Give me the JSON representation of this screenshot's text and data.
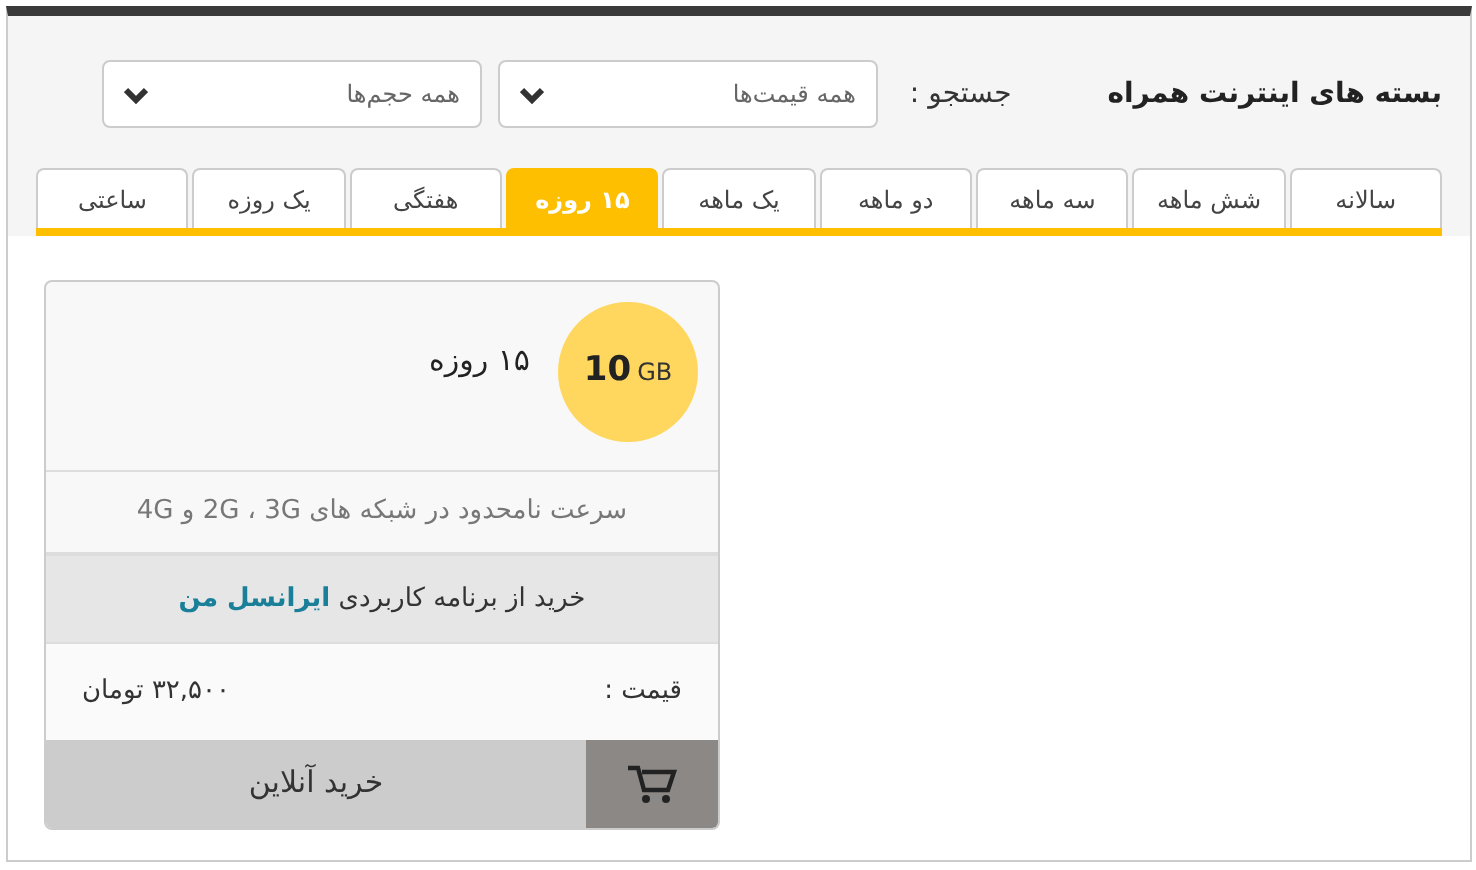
{
  "header": {
    "title": "بسته های اینترنت همراه",
    "search_label": "جستجو :",
    "filters": [
      {
        "value": "همه قیمت‌ها"
      },
      {
        "value": "همه حجم‌ها"
      }
    ]
  },
  "tabs": [
    {
      "label": "سالانه",
      "selected": false
    },
    {
      "label": "شش ماهه",
      "selected": false
    },
    {
      "label": "سه ماهه",
      "selected": false
    },
    {
      "label": "دو ماهه",
      "selected": false
    },
    {
      "label": "یک ماهه",
      "selected": false
    },
    {
      "label": "۱۵ روزه",
      "selected": true
    },
    {
      "label": "هفتگی",
      "selected": false
    },
    {
      "label": "یک روزه",
      "selected": false
    },
    {
      "label": "ساعتی",
      "selected": false
    }
  ],
  "package": {
    "volume": "10",
    "unit": "GB",
    "title": "۱۵ روزه",
    "description": "سرعت نامحدود در شبکه های 2G ، 3G و 4G",
    "app_text": "خرید از برنامه کاربردی",
    "app_link": "ایرانسل من",
    "price_label": "قیمت :",
    "price": "۳۲,۵۰۰ تومان",
    "buy_button": "خرید آنلاین"
  }
}
